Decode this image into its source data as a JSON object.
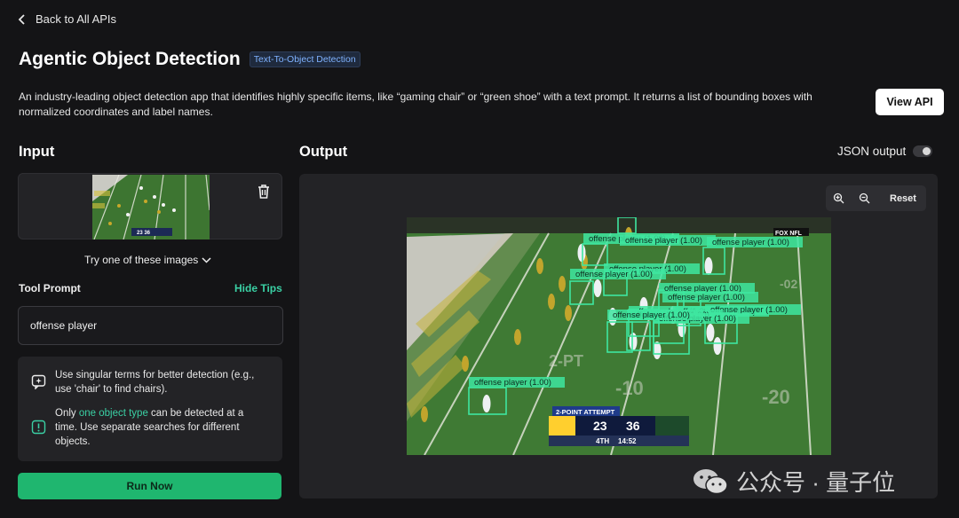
{
  "nav": {
    "back_label": "Back to All APIs"
  },
  "header": {
    "title": "Agentic Object Detection",
    "tag": "Text-To-Object Detection",
    "description": "An industry-leading object detection app that identifies highly specific items, like “gaming chair” or “green shoe” with a text prompt. It returns a list of bounding boxes with normalized coordinates and label names.",
    "view_api_label": "View API"
  },
  "input": {
    "section_title": "Input",
    "try_images_label": "Try one of these images",
    "tool_prompt_label": "Tool Prompt",
    "hide_tips_label": "Hide Tips",
    "prompt_value": "offense player",
    "tip1": "Use singular terms for better detection (e.g., use 'chair' to find chairs).",
    "tip2_prefix": "Only ",
    "tip2_link": "one object type",
    "tip2_suffix": " can be detected at a time. Use separate searches for different objects.",
    "run_label": "Run Now"
  },
  "output": {
    "section_title": "Output",
    "json_toggle_label": "JSON output",
    "json_toggle_on": false,
    "reset_label": "Reset",
    "box_label": "offense player (1.00)",
    "detection_count": 14,
    "scoreboard": {
      "banner": "2-POINT ATTEMPT",
      "away_score": "23",
      "home_score": "36",
      "quarter": "4TH",
      "clock": "14:52",
      "network": "FOX NFL"
    }
  },
  "watermark": {
    "text": "公众号 · 量子位"
  },
  "colors": {
    "accent": "#3ad0a4",
    "run_button": "#1fb66f",
    "box": "#3ee6a0",
    "field_grass": "#3f7a34"
  }
}
